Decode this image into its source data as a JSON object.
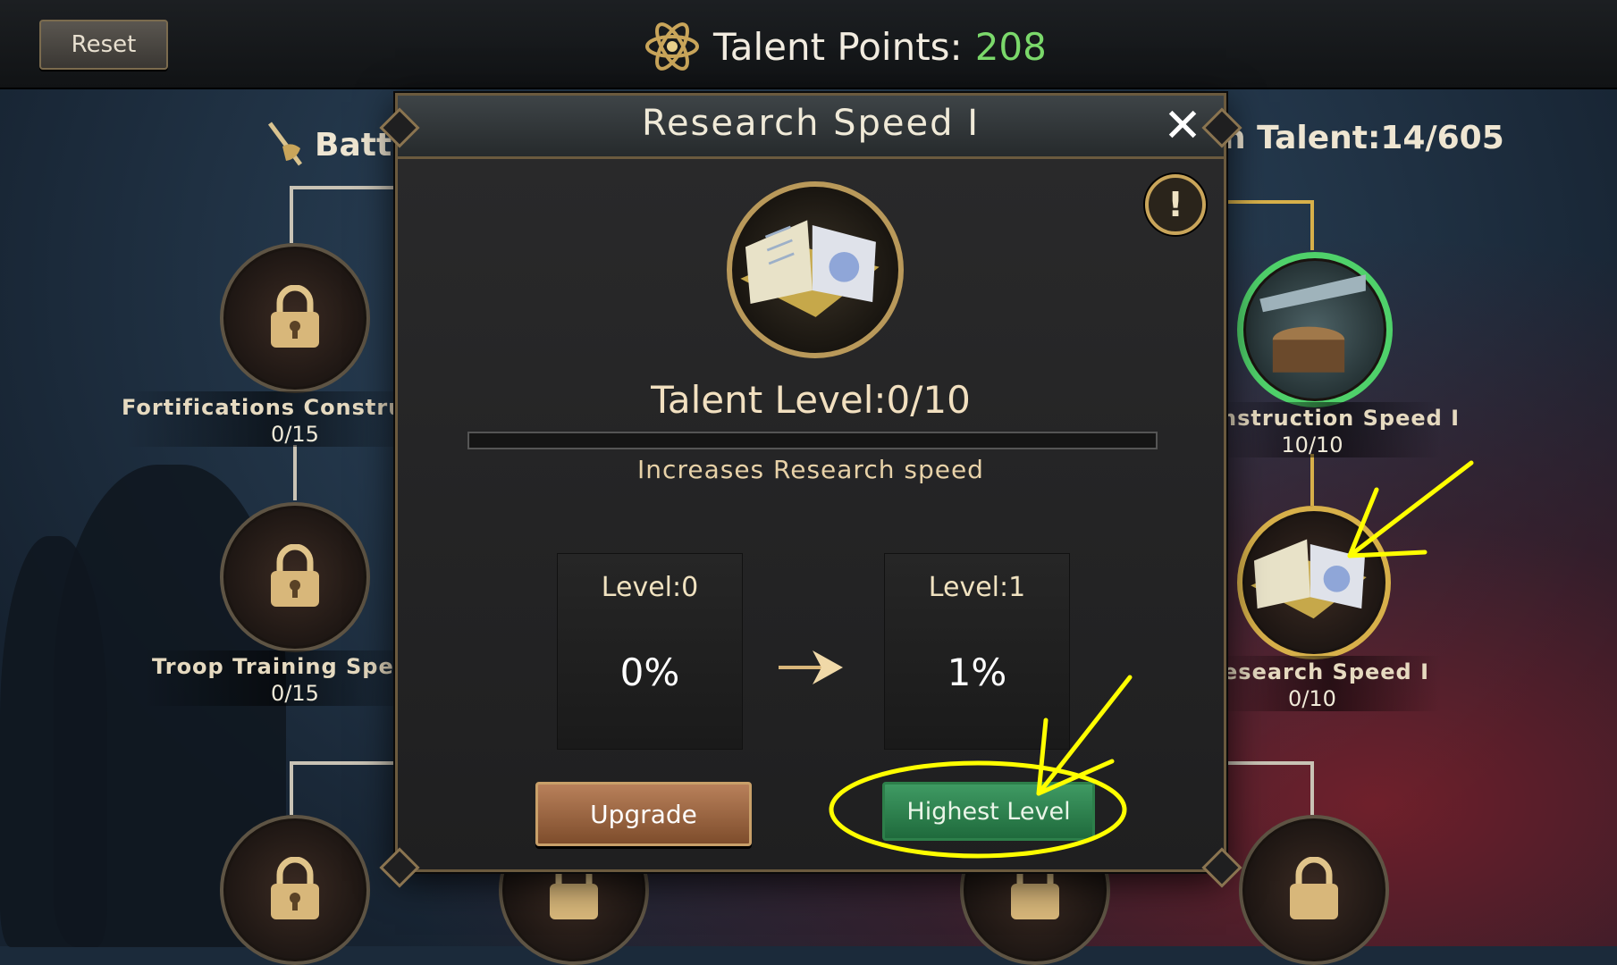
{
  "topbar": {
    "reset_label": "Reset",
    "talent_points_label": "Talent Points:",
    "talent_points_value": "208"
  },
  "left_section": {
    "title": "Battl"
  },
  "right_section": {
    "title": "n Talent:14/605"
  },
  "nodes": [
    {
      "label": "Fortifications Construc",
      "count": "0/15"
    },
    {
      "label": "Troop Training Spee",
      "count": "0/15"
    },
    {
      "label": "nstruction Speed I",
      "count": "10/10"
    },
    {
      "label": "esearch Speed I",
      "count": "0/10"
    }
  ],
  "modal": {
    "title": "Research Speed I",
    "talent_level": "Talent Level:0/10",
    "progress": 0,
    "description": "Increases Research speed",
    "current": {
      "level": "Level:0",
      "value": "0%"
    },
    "next": {
      "level": "Level:1",
      "value": "1%"
    },
    "upgrade_label": "Upgrade",
    "highest_label": "Highest Level"
  },
  "colors": {
    "accent_green": "#7bd96b",
    "annotation_yellow": "#ffff00",
    "frame_gold": "#6b5a3e"
  },
  "icons": [
    "atom-icon",
    "lock-icon",
    "book-icon",
    "close-icon",
    "info-icon",
    "arrow-right-icon",
    "saw-stump-icon"
  ]
}
